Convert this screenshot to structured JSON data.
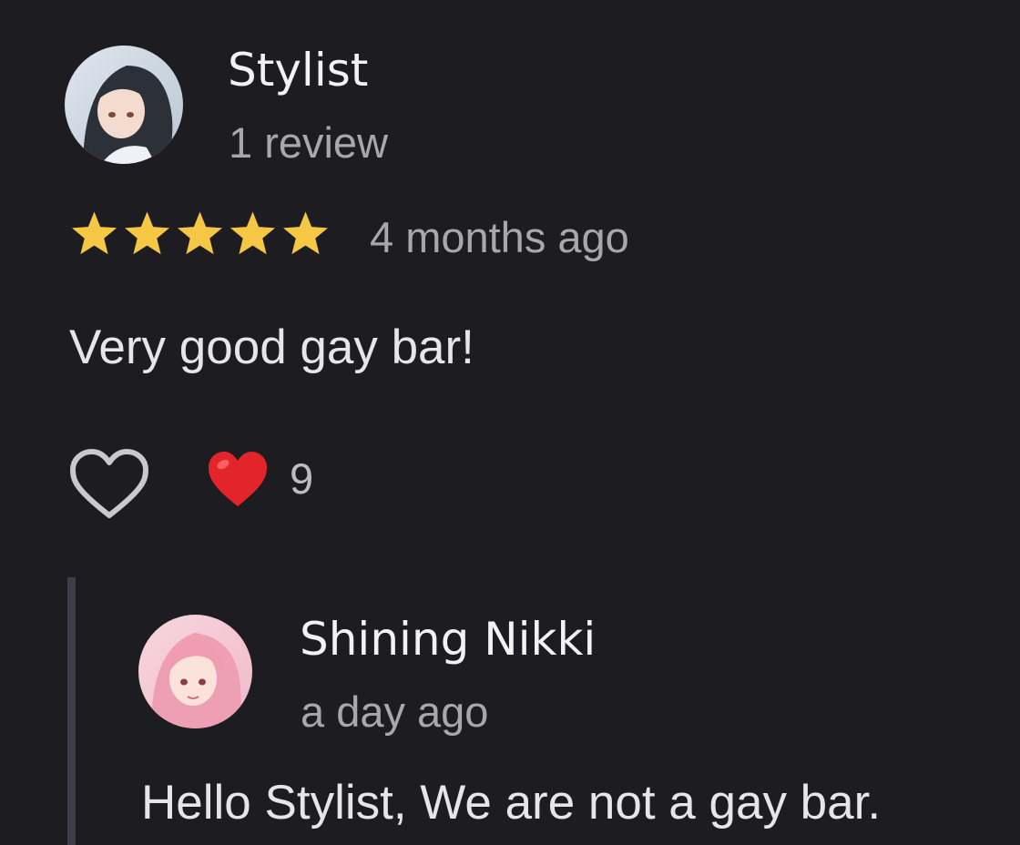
{
  "review": {
    "author_name": "Stylist",
    "author_reviews": "1 review",
    "rating": 5,
    "rating_max": 5,
    "time": "4 months ago",
    "text": "Very good gay bar!",
    "like_icon": "heart-outline-icon",
    "reaction_icon": "red-heart-emoji",
    "reaction_count": "9"
  },
  "reply": {
    "author_name": "Shining Nikki",
    "time": "a day ago",
    "text": "Hello Stylist, We are not a gay bar."
  },
  "colors": {
    "background": "#1d1d21",
    "star": "#f6c744",
    "reaction_heart": "#e3242b",
    "reply_bar": "#3e3f44"
  }
}
